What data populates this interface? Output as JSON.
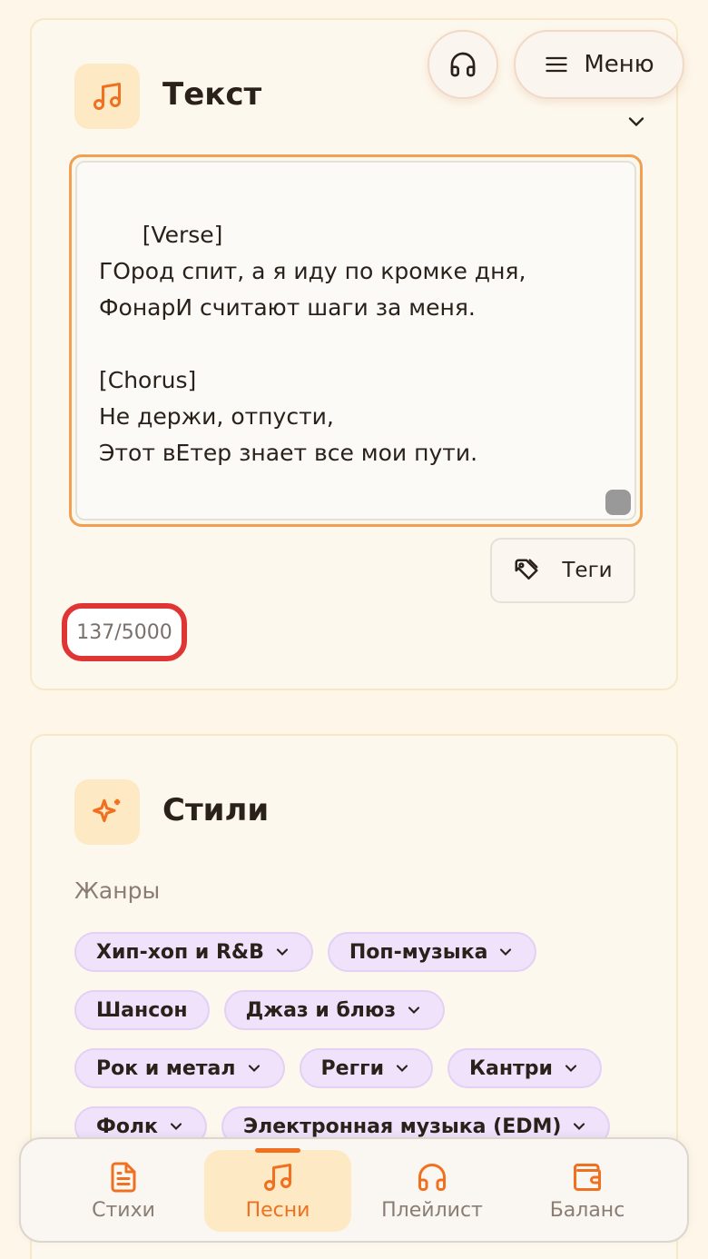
{
  "colors": {
    "accent": "#f07020",
    "chip_bg": "#efe2fa",
    "counter_highlight": "#e03535",
    "textarea_focus": "#f0a050"
  },
  "header": {
    "listen_icon": "headphones-icon",
    "menu_label": "Меню",
    "menu_icon": "hamburger-icon"
  },
  "text_card": {
    "icon": "music-note-icon",
    "title": "Текст",
    "lyrics": "[Verse]\nГОрод спит, а я иду по кромке дня,\nФонарИ считают шаги за меня.\n\n[Chorus]\nНе держи, отпусти,\nЭтот вЕтер знает все мои пути.",
    "tags_label": "Теги",
    "tags_icon": "tags-icon",
    "char_counter": "137/5000"
  },
  "styles_card": {
    "icon": "sparkles-icon",
    "title": "Стили",
    "genres_label": "Жанры",
    "genre_rows": [
      [
        {
          "label": "Хип-хоп и R&B",
          "has_dropdown": true
        },
        {
          "label": "Поп-музыка",
          "has_dropdown": true
        }
      ],
      [
        {
          "label": "Шансон",
          "has_dropdown": false
        },
        {
          "label": "Джаз и блюз",
          "has_dropdown": true
        }
      ],
      [
        {
          "label": "Рок и метал",
          "has_dropdown": true
        },
        {
          "label": "Регги",
          "has_dropdown": true
        },
        {
          "label": "Кантри",
          "has_dropdown": true
        }
      ],
      [
        {
          "label": "Фолк",
          "has_dropdown": true
        },
        {
          "label": "Электронная музыка (EDM)",
          "has_dropdown": true
        }
      ]
    ]
  },
  "bottom_nav": {
    "items": [
      {
        "label": "Стихи",
        "icon": "document-icon",
        "active": false
      },
      {
        "label": "Песни",
        "icon": "music-note-icon",
        "active": true
      },
      {
        "label": "Плейлист",
        "icon": "headphones-icon",
        "active": false
      },
      {
        "label": "Баланс",
        "icon": "wallet-icon",
        "active": false
      }
    ]
  }
}
